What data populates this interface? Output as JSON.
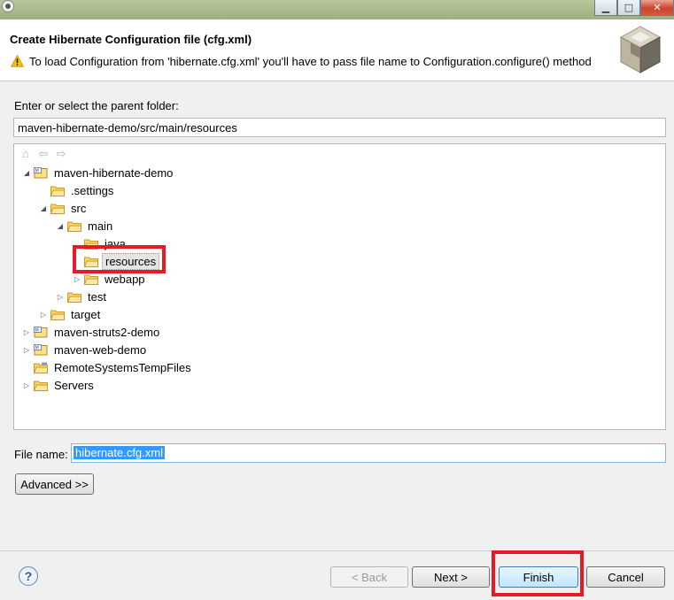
{
  "window": {
    "icon": "eclipse-app-icon",
    "controls": {
      "minimize": "▁",
      "maximize": "□",
      "close": "✕"
    }
  },
  "header": {
    "title": "Create Hibernate Configuration file (cfg.xml)",
    "message": "To load Configuration from 'hibernate.cfg.xml' you'll have to pass file name to Configuration.configure() method",
    "message_icon": "warning-icon",
    "logo": "hibernate-logo"
  },
  "folder": {
    "label": "Enter or select the parent folder:",
    "path": "maven-hibernate-demo/src/main/resources"
  },
  "tree_toolbar": [
    "home-icon",
    "back-arrow-icon",
    "forward-arrow-icon"
  ],
  "tree": [
    {
      "label": "maven-hibernate-demo",
      "type": "project",
      "expanded": true
    },
    {
      "label": ".settings",
      "type": "folder"
    },
    {
      "label": "src",
      "type": "folder",
      "expanded": true
    },
    {
      "label": "main",
      "type": "folder",
      "expanded": true
    },
    {
      "label": "java",
      "type": "folder"
    },
    {
      "label": "resources",
      "type": "folder",
      "selected": true
    },
    {
      "label": "webapp",
      "type": "folder",
      "expanded": false
    },
    {
      "label": "test",
      "type": "folder",
      "expanded": false
    },
    {
      "label": "target",
      "type": "folder",
      "expanded": false
    },
    {
      "label": "maven-struts2-demo",
      "type": "project",
      "expanded": false
    },
    {
      "label": "maven-web-demo",
      "type": "project",
      "expanded": false
    },
    {
      "label": "RemoteSystemsTempFiles",
      "type": "project"
    },
    {
      "label": "Servers",
      "type": "folder",
      "expanded": false
    }
  ],
  "file": {
    "label": "File name:",
    "value": "hibernate.cfg.xml"
  },
  "buttons": {
    "advanced": "Advanced >>",
    "back": "< Back",
    "next": "Next >",
    "finish": "Finish",
    "cancel": "Cancel",
    "help": "?"
  },
  "colors": {
    "highlight_box": "#e41b24",
    "selection": "#3399ff"
  }
}
